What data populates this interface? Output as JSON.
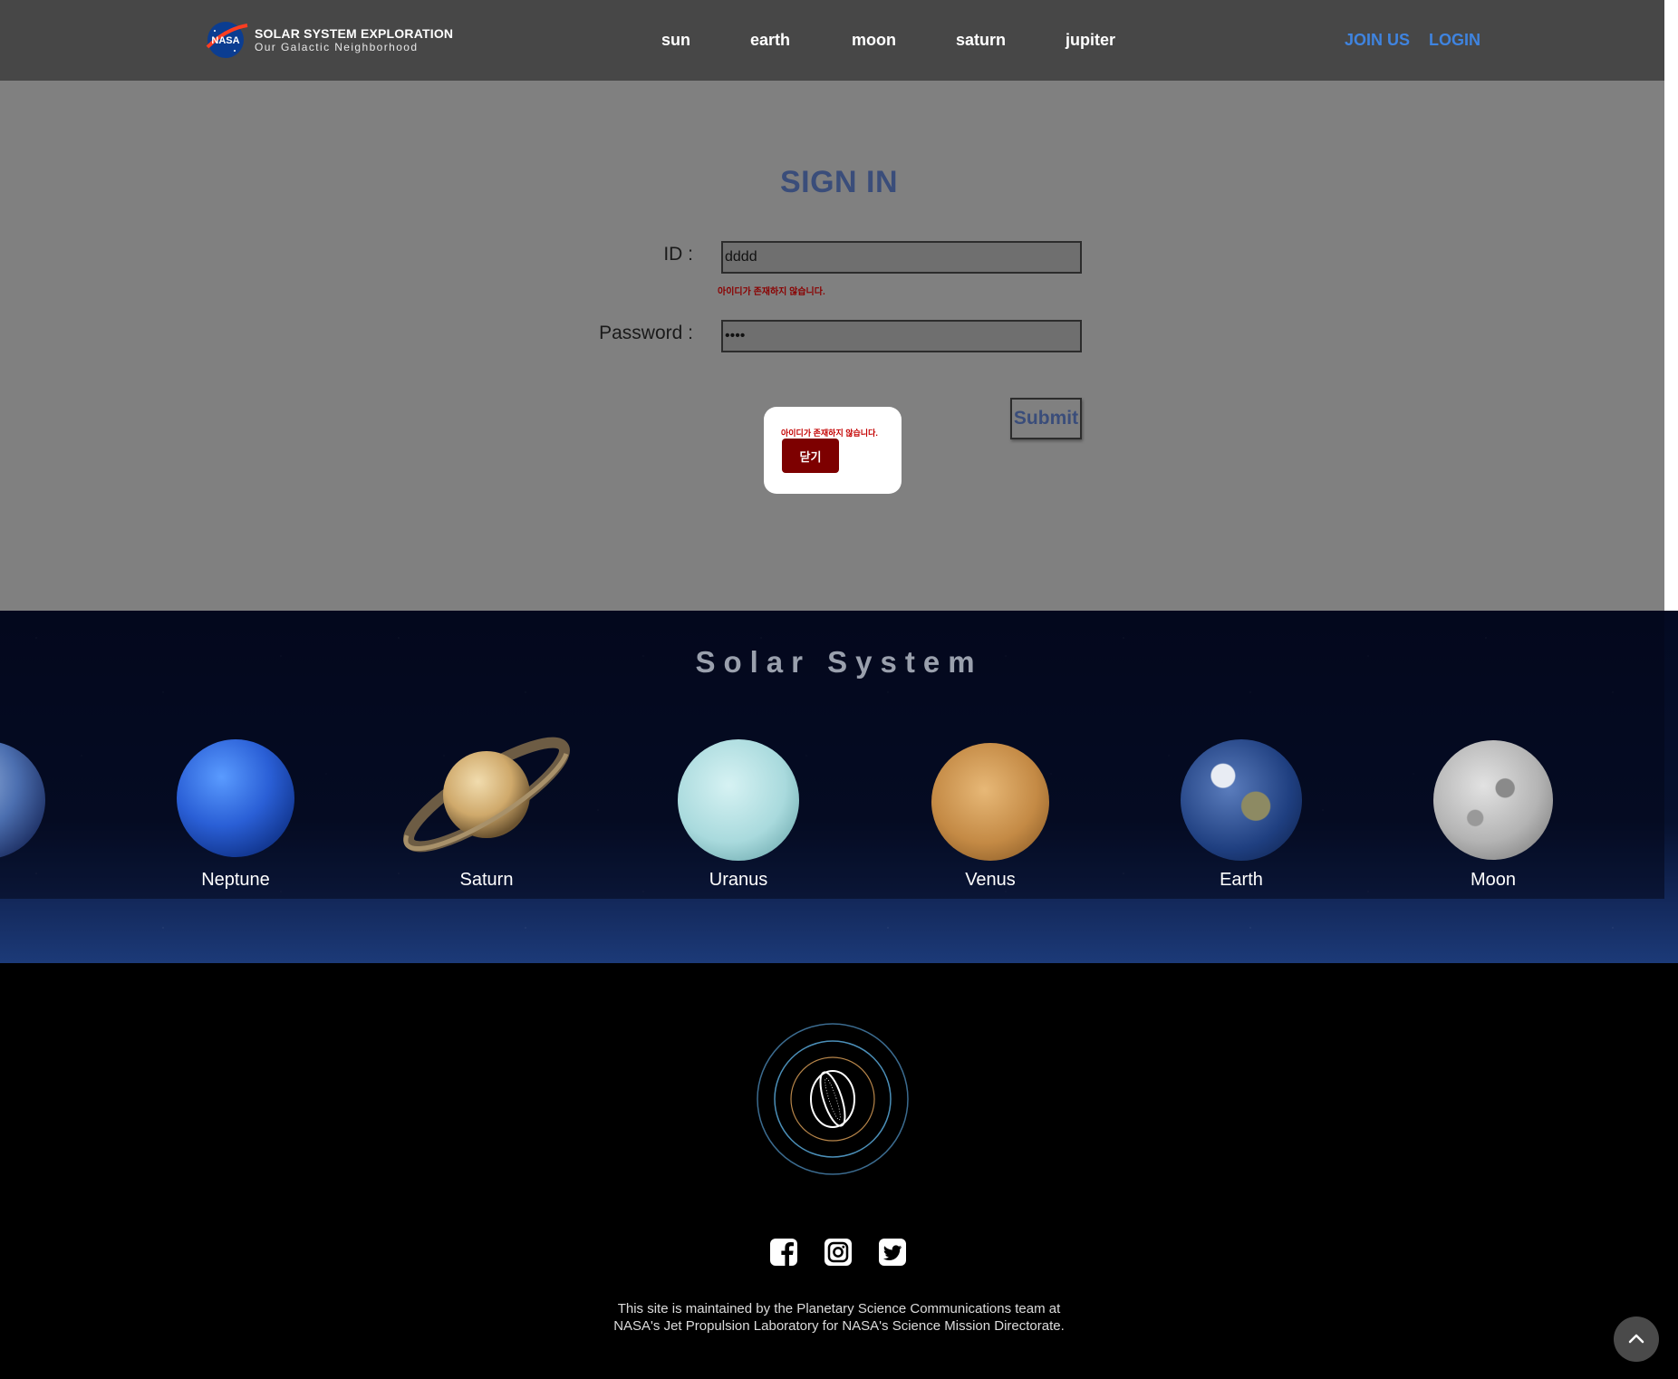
{
  "header": {
    "brand_badge": "NASA",
    "brand_title": "SOLAR SYSTEM EXPLORATION",
    "brand_subtitle": "Our Galactic Neighborhood",
    "nav": [
      "sun",
      "earth",
      "moon",
      "saturn",
      "jupiter"
    ],
    "join_label": "JOIN US",
    "login_label": "LOGIN",
    "colors": {
      "bar": "#474747",
      "auth_link": "#3f84e0"
    }
  },
  "signin": {
    "title": "SIGN IN",
    "id_label": "ID :",
    "id_value": "dddd",
    "id_error": "아이디가 존재하지 않습니다.",
    "password_label": "Password :",
    "password_value": "••••",
    "submit_label": "Submit"
  },
  "dialog": {
    "message": "아이디가 존재하지 않습니다.",
    "close_label": "닫기",
    "colors": {
      "message": "#c40000",
      "button": "#7d0000"
    }
  },
  "planets": {
    "title": "Solar System",
    "items": [
      {
        "name": "ry",
        "icon": "mercury-planet-icon"
      },
      {
        "name": "Neptune",
        "icon": "neptune-planet-icon"
      },
      {
        "name": "Saturn",
        "icon": "saturn-planet-icon"
      },
      {
        "name": "Uranus",
        "icon": "uranus-planet-icon"
      },
      {
        "name": "Venus",
        "icon": "venus-planet-icon"
      },
      {
        "name": "Earth",
        "icon": "earth-planet-icon"
      },
      {
        "name": "Moon",
        "icon": "moon-planet-icon"
      }
    ]
  },
  "footer": {
    "logo_icon": "orbit-logo-icon",
    "social": [
      "facebook-icon",
      "instagram-icon",
      "twitter-icon"
    ],
    "credit_line1": "This site is maintained by the Planetary Science Communications team at",
    "credit_line2": "NASA's Jet Propulsion Laboratory for NASA's Science Mission Directorate.",
    "back_to_top_icon": "chevron-up-icon"
  }
}
